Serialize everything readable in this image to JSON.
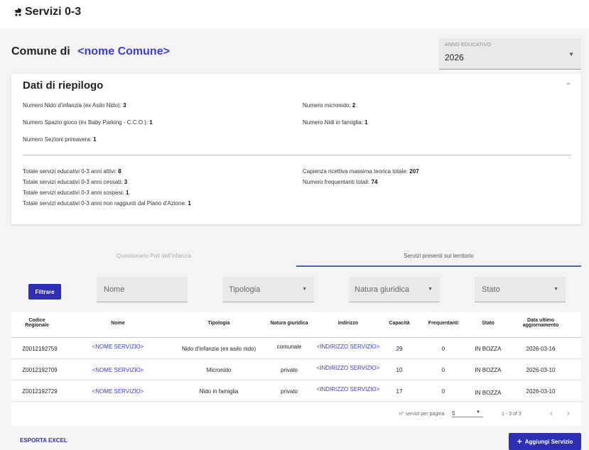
{
  "app": {
    "title": "Servizi 0-3",
    "icon": "stroller-icon"
  },
  "header": {
    "comune_label": "Comune di",
    "comune_name": "<nome Comune>"
  },
  "anno_educativo": {
    "label": "ANNO EDUCATIVO",
    "value": "2026"
  },
  "summary": {
    "title": "Dati di riepilogo",
    "stats": [
      {
        "label": "Numero Nido d'infanzia (ex Asilo Nido): ",
        "value": "3"
      },
      {
        "label": "Numero micronido: ",
        "value": "2"
      },
      {
        "label": "Numero Spazio gioco (ex Baby Parking - C.C.O.): ",
        "value": "1"
      },
      {
        "label": "Numero Nidi in famiglia: ",
        "value": "1"
      },
      {
        "label": "Numero Sezioni primavera: ",
        "value": "1"
      },
      {
        "label": "Totale servizi educativi 0-3 anni attivi: ",
        "value": "8"
      },
      {
        "label": "Capienza ricettiva massima teorica totale: ",
        "value": "207"
      },
      {
        "label": "Totale servizi educativi 0-3 anni cessati: ",
        "value": "3"
      },
      {
        "label": "Numero frequentanti totali: ",
        "value": "74"
      },
      {
        "label": "Totale servizi educativi 0-3 anni sospesi: ",
        "value": "1"
      },
      {
        "label": "Totale servizi educativi 0-3 anni non raggiunti dal Piano d'Azione: ",
        "value": "1"
      }
    ]
  },
  "tabs": [
    {
      "label": "Questionario Poli dell'Infanzia",
      "active": false
    },
    {
      "label": "Servizi presenti sul territorio",
      "active": true
    }
  ],
  "filters": {
    "button": "Filtrare",
    "nome": "Nome",
    "tipologia": "Tipologia",
    "natura": "Natura giuridica",
    "stato": "Stato"
  },
  "table": {
    "headers": [
      "Codice\nRegionale",
      "Nome",
      "Tipologia",
      "Natura giuridica",
      "Indirizzo",
      "Capacità",
      "Frequentanti",
      "Stato",
      "Data ultimo\naggiornamento"
    ],
    "rows": [
      [
        "Z0012192759",
        "<NOME SERVIZIO>",
        "Nido d'infanzia (ex asilo nido)",
        "comunale",
        "<INDIRIZZO SERVIZIO>",
        "29",
        "0",
        "IN BOZZA",
        "2026-03-16"
      ],
      [
        "Z0012192709",
        "<NOME SERVIZIO>",
        "Micronido",
        "privato",
        "<INDIRIZZO SERVIZIO>",
        "10",
        "0",
        "IN BOZZA",
        "2026-03-10"
      ],
      [
        "Z0012192729",
        "<NOME SERVIZIO>",
        "Nido in famiglia",
        "privato",
        "<INDIRIZZO SERVIZIO>",
        "17",
        "0",
        "IN BOZZA",
        "2026-03-10"
      ]
    ]
  },
  "pagination": {
    "label": "n° servizi per pagina",
    "per_page": "5",
    "range": "1 - 3 of 3"
  },
  "footer": {
    "export": "ESPORTA EXCEL",
    "add": "Aggiungi Servizio"
  },
  "colors": {
    "accent": "#2f2fb5",
    "link": "#3b3bd8",
    "tab_underline": "#4b5bd0"
  }
}
